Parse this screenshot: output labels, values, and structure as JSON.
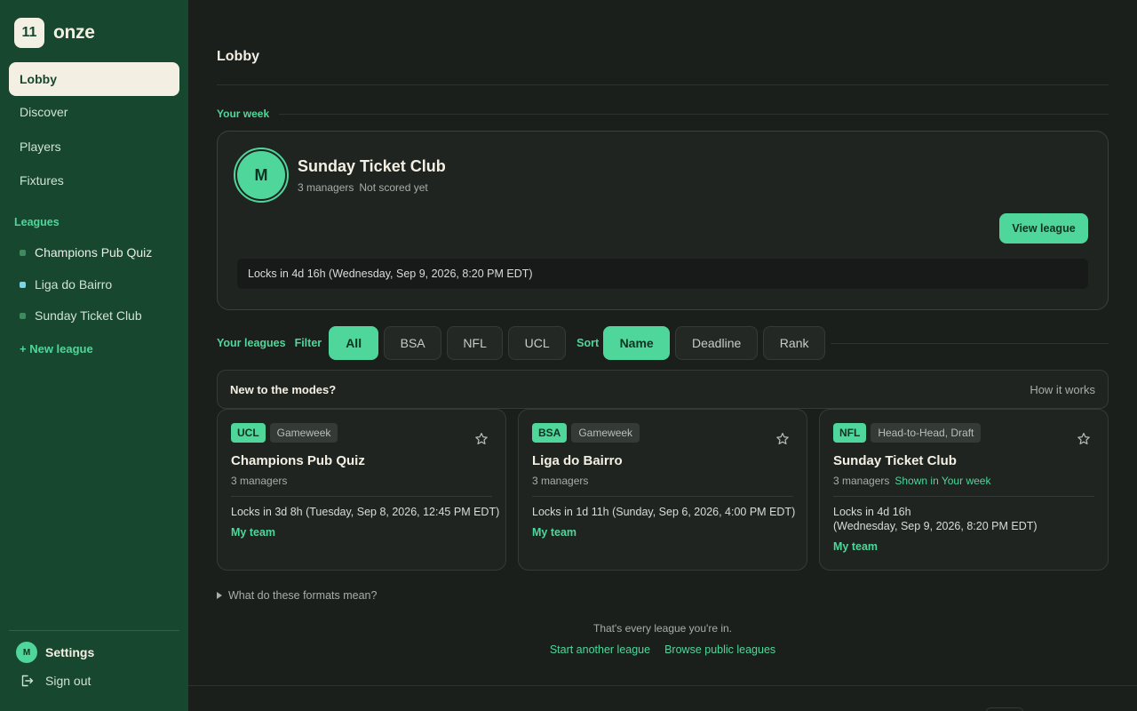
{
  "brand": {
    "logo": "11",
    "name": "onze"
  },
  "nav": [
    {
      "label": "Lobby",
      "active": true
    },
    {
      "label": "Discover"
    },
    {
      "label": "Players"
    },
    {
      "label": "Fixtures"
    }
  ],
  "sidebar": {
    "leagues_heading": "Leagues",
    "leagues": [
      "Champions Pub Quiz",
      "Liga do Bairro",
      "Sunday Ticket Club"
    ],
    "new_league": "+ New league",
    "settings_avatar": "M",
    "settings_label": "Settings",
    "signout_label": "Sign out"
  },
  "page": {
    "title": "Lobby"
  },
  "your_week": {
    "label": "Your week",
    "avatar": "M",
    "name": "Sunday Ticket Club",
    "managers": "3 managers",
    "status": "Not scored yet",
    "button": "View league",
    "lock": "Locks in 4d 16h (Wednesday, Sep 9, 2026, 8:20 PM EDT)"
  },
  "filters": {
    "your_leagues": "Your leagues",
    "filter_label": "Filter",
    "filter_options": [
      "All",
      "BSA",
      "NFL",
      "UCL"
    ],
    "sort_label": "Sort",
    "sort_options": [
      "Name",
      "Deadline",
      "Rank"
    ]
  },
  "intro": {
    "title": "New to the modes?",
    "link": "How it works"
  },
  "cards": [
    {
      "comp": "UCL",
      "mode": "Gameweek",
      "name": "Champions Pub Quiz",
      "managers": "3 managers",
      "highlight": "",
      "lock_line1": "Locks in 3d 8h (Tuesday, Sep 8, 2026, 12:45 PM EDT)",
      "lock_line2": "",
      "link": "My team"
    },
    {
      "comp": "BSA",
      "mode": "Gameweek",
      "name": "Liga do Bairro",
      "managers": "3 managers",
      "highlight": "",
      "lock_line1": "Locks in 1d 11h (Sunday, Sep 6, 2026, 4:00 PM EDT)",
      "lock_line2": "",
      "link": "My team"
    },
    {
      "comp": "NFL",
      "mode": "Head-to-Head, Draft",
      "name": "Sunday Ticket Club",
      "managers": "3 managers",
      "highlight": "Shown in Your week",
      "lock_line1": "Locks in 4d 16h",
      "lock_line2": "(Wednesday, Sep 9, 2026, 8:20 PM EDT)",
      "link": "My team"
    }
  ],
  "footer": {
    "formats": "What do these formats mean?",
    "end_note": "That's every league you're in.",
    "start_link": "Start another league",
    "browse_link": "Browse public leagues"
  },
  "colors": {
    "sidebar": "#17472f",
    "accent": "#4fd69a",
    "background": "#1b1f1c",
    "cream": "#f3efe3"
  }
}
